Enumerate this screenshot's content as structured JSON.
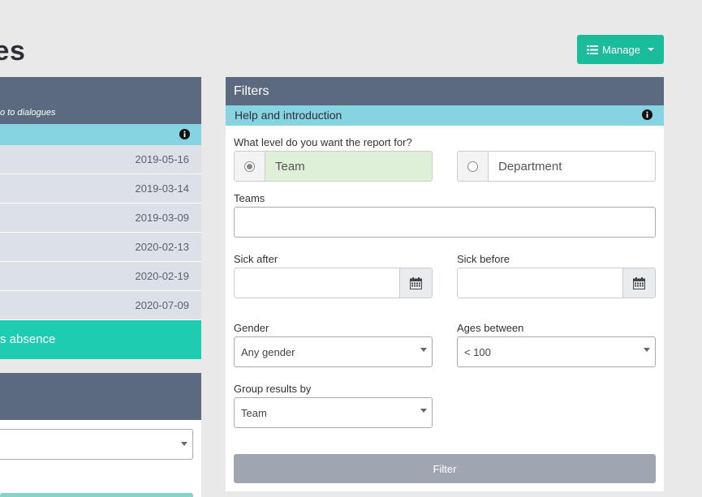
{
  "page": {
    "title_visible": "gues"
  },
  "header": {
    "manage_label": "Manage"
  },
  "left": {
    "subtitle": "o to dialogues",
    "dates": [
      "2019-05-16",
      "2019-03-14",
      "2019-03-09",
      "2020-02-13",
      "2020-02-19",
      "2020-07-09"
    ],
    "absence_label": "s absence"
  },
  "filters": {
    "title": "Filters",
    "help_label": "Help and introduction",
    "level_question": "What level do you want the report for?",
    "level_options": [
      {
        "label": "Team",
        "selected": true
      },
      {
        "label": "Department",
        "selected": false
      }
    ],
    "teams_label": "Teams",
    "teams_value": "",
    "sick_after_label": "Sick after",
    "sick_before_label": "Sick before",
    "gender_label": "Gender",
    "gender_value": "Any gender",
    "ages_label": "Ages between",
    "ages_value": "< 100",
    "group_label": "Group results by",
    "group_value": "Team",
    "filter_button": "Filter"
  },
  "colors": {
    "accent": "#1abc9c",
    "panel_header": "#5c6a80",
    "info_bar": "#86d3e2",
    "selected_option": "#dff0d8"
  }
}
